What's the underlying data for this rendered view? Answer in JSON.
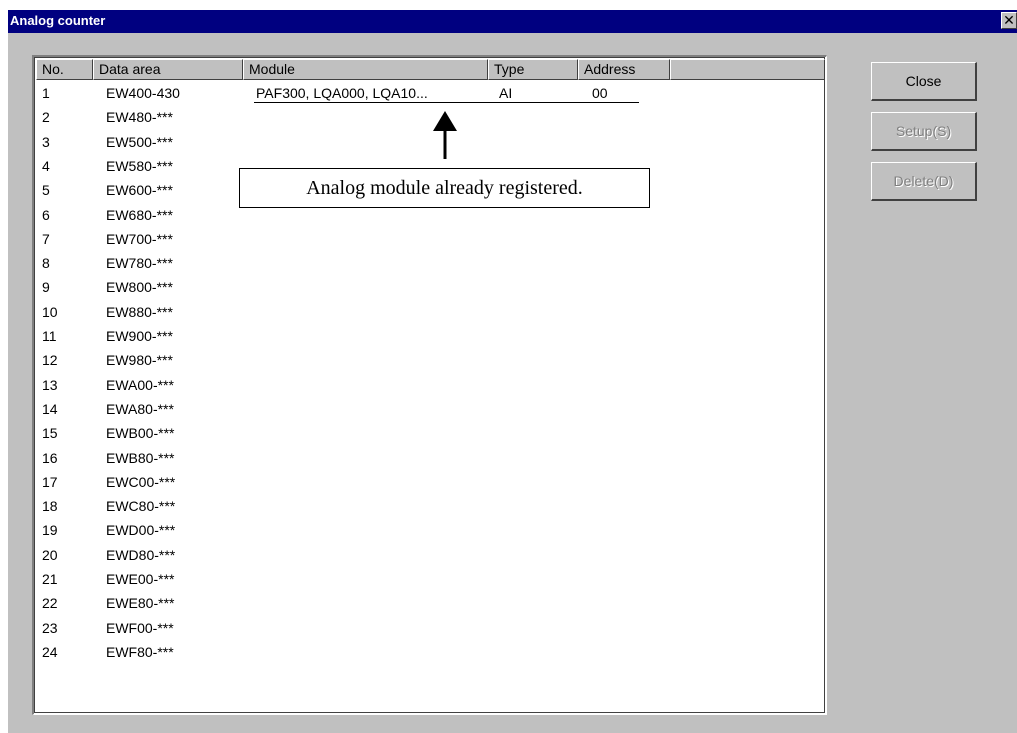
{
  "window": {
    "title": "Analog counter",
    "close_glyph": "✕"
  },
  "list": {
    "columns": [
      "No.",
      "Data area",
      "Module",
      "Type",
      "Address"
    ],
    "rows": [
      {
        "no": "1",
        "area": "EW400-430",
        "module": "PAF300, LQA000, LQA10...",
        "type": "AI",
        "address": "00"
      },
      {
        "no": "2",
        "area": "EW480-***"
      },
      {
        "no": "3",
        "area": "EW500-***"
      },
      {
        "no": "4",
        "area": "EW580-***"
      },
      {
        "no": "5",
        "area": "EW600-***"
      },
      {
        "no": "6",
        "area": "EW680-***"
      },
      {
        "no": "7",
        "area": "EW700-***"
      },
      {
        "no": "8",
        "area": "EW780-***"
      },
      {
        "no": "9",
        "area": "EW800-***"
      },
      {
        "no": "10",
        "area": "EW880-***"
      },
      {
        "no": "11",
        "area": "EW900-***"
      },
      {
        "no": "12",
        "area": "EW980-***"
      },
      {
        "no": "13",
        "area": "EWA00-***"
      },
      {
        "no": "14",
        "area": "EWA80-***"
      },
      {
        "no": "15",
        "area": "EWB00-***"
      },
      {
        "no": "16",
        "area": "EWB80-***"
      },
      {
        "no": "17",
        "area": "EWC00-***"
      },
      {
        "no": "18",
        "area": "EWC80-***"
      },
      {
        "no": "19",
        "area": "EWD00-***"
      },
      {
        "no": "20",
        "area": "EWD80-***"
      },
      {
        "no": "21",
        "area": "EWE00-***"
      },
      {
        "no": "22",
        "area": "EWE80-***"
      },
      {
        "no": "23",
        "area": "EWF00-***"
      },
      {
        "no": "24",
        "area": "EWF80-***"
      }
    ]
  },
  "buttons": {
    "close": "Close",
    "setup": "Setup(S)",
    "delete": "Delete(D)"
  },
  "callout": {
    "text": "Analog module already registered."
  },
  "colors": {
    "titlebar": "#000080",
    "dialog_face": "#c0c0c0",
    "disabled_text": "#808080"
  }
}
